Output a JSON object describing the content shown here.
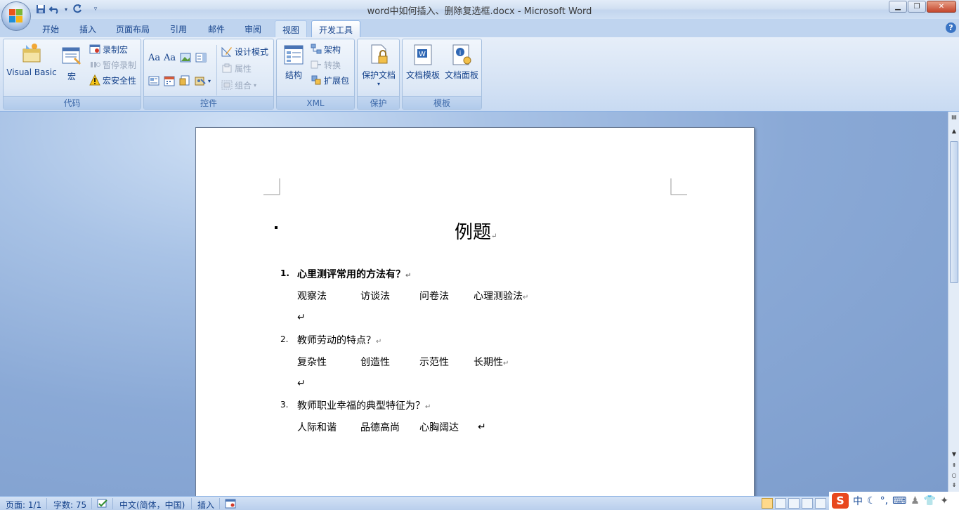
{
  "window": {
    "title": "word中如何插入、删除复选框.docx - Microsoft Word",
    "controls": [
      "minimize",
      "maximize",
      "close"
    ]
  },
  "quick_access": [
    "save-icon",
    "undo-icon",
    "redo-icon",
    "customize-icon"
  ],
  "tabs": [
    {
      "label": "开始"
    },
    {
      "label": "插入"
    },
    {
      "label": "页面布局"
    },
    {
      "label": "引用"
    },
    {
      "label": "邮件"
    },
    {
      "label": "审阅"
    },
    {
      "label": "视图"
    },
    {
      "label": "开发工具"
    }
  ],
  "active_tab": "开发工具",
  "ribbon": {
    "code": {
      "label": "代码",
      "visual_basic": "Visual Basic",
      "macros": "宏",
      "record_macro": "录制宏",
      "pause_recording": "暂停录制",
      "macro_security": "宏安全性"
    },
    "controls": {
      "label": "控件",
      "design_mode": "设计模式",
      "properties": "属性",
      "group": "组合",
      "aa1": "Aa",
      "aa2": "Aa"
    },
    "xml": {
      "label": "XML",
      "structure": "结构",
      "schema": "架构",
      "transform": "转换",
      "expansion_pack": "扩展包"
    },
    "protect": {
      "label": "保护",
      "protect_document": "保护文档"
    },
    "templates": {
      "label": "模板",
      "document_template": "文档模板",
      "document_panel": "文档面板"
    }
  },
  "document": {
    "title": "例题",
    "questions": [
      {
        "number": "1.",
        "text": "心里测评常用的方法有？",
        "bold": true,
        "options": [
          "观察法",
          "访谈法",
          "问卷法",
          "心理测验法"
        ]
      },
      {
        "number": "2.",
        "text": "教师劳动的特点？",
        "bold": false,
        "options": [
          "复杂性",
          "创造性",
          "示范性",
          "长期性"
        ]
      },
      {
        "number": "3.",
        "text": "教师职业幸福的典型特征为？",
        "bold": false,
        "options": [
          "人际和谐",
          "品德高尚",
          "心胸阔达"
        ]
      }
    ],
    "return_mark": "↵"
  },
  "status_bar": {
    "page": "页面: 1/1",
    "words": "字数: 75",
    "language": "中文(简体，中国)",
    "mode": "插入"
  },
  "ime": {
    "mode": "中"
  },
  "colors": {
    "ribbon_text": "#15428b",
    "doc_background": "#8aa9d6",
    "accent": "#3e6aaa"
  }
}
